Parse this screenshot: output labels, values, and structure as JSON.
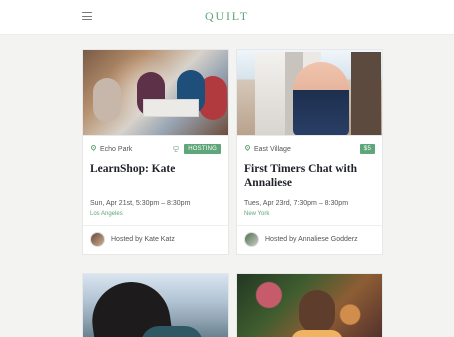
{
  "app": {
    "brand": "QUILT"
  },
  "colors": {
    "accent": "#5fa67a",
    "background": "#f3f3f1",
    "card": "#ffffff"
  },
  "header": {
    "menu_icon": "menu-icon"
  },
  "cards": [
    {
      "location": "Echo Park",
      "badge": "HOSTING",
      "title": "LearnShop: Kate",
      "date": "Sun, Apr 21st, 5:30pm – 8:30pm",
      "city": "Los Angeles",
      "host": "Hosted by Kate Katz"
    },
    {
      "location": "East Village",
      "badge": "$5",
      "title": "First Timers Chat with Annaliese",
      "date": "Tues, Apr 23rd, 7:30pm – 8:30pm",
      "city": "New York",
      "host": "Hosted by Annaliese Godderz"
    }
  ]
}
